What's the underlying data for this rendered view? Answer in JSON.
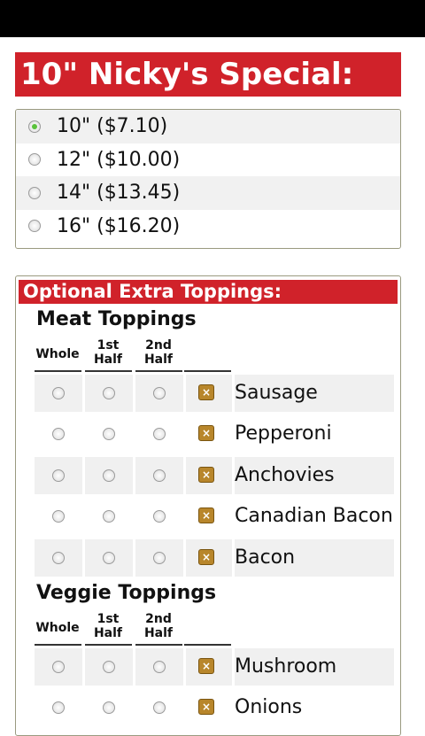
{
  "page": {
    "title": "10\" Nicky's Special:"
  },
  "sizes": [
    {
      "label": "10\" ($7.10)",
      "selected": true
    },
    {
      "label": "12\" ($10.00)",
      "selected": false
    },
    {
      "label": "14\" ($13.45)",
      "selected": false
    },
    {
      "label": "16\" ($16.20)",
      "selected": false
    }
  ],
  "toppings": {
    "header": "Optional Extra Toppings:",
    "columns": {
      "whole": "Whole",
      "first_half": "1st Half",
      "second_half": "2nd Half"
    },
    "meat": {
      "title": "Meat Toppings",
      "items": [
        "Sausage",
        "Pepperoni",
        "Anchovies",
        "Canadian Bacon",
        "Bacon"
      ]
    },
    "veggie": {
      "title": "Veggie Toppings",
      "items": [
        "Mushroom",
        "Onions"
      ]
    }
  },
  "colors": {
    "banner_red": "#d0222a",
    "selected_radio": "#59c23a",
    "remove_icon": "#b8862b"
  },
  "icons": {
    "remove": "x-box-icon",
    "radio": "radio-button-icon"
  }
}
